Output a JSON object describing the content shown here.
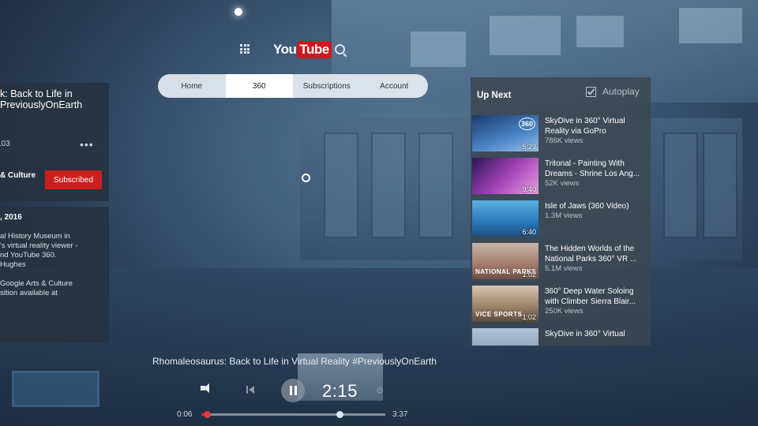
{
  "nav": {
    "tabs": [
      {
        "label": "Home"
      },
      {
        "label": "360",
        "active": true
      },
      {
        "label": "Subscriptions"
      },
      {
        "label": "Account"
      }
    ],
    "logo_you": "You",
    "logo_tube": "Tube"
  },
  "video_info": {
    "title_line1": "k: Back to Life in",
    "title_line2": "PreviouslyOnEarth",
    "likes": "103",
    "channel": "& Culture",
    "subscribe_label": "Subscribed",
    "date": ", 2016",
    "description": [
      "al History Museum in",
      "'s virtual reality viewer -",
      "nd YouTube 360.",
      "Hughes",
      "",
      "Google Arts & Culture",
      "sition available at"
    ]
  },
  "up_next": {
    "heading": "Up Next",
    "autoplay_label": "Autoplay",
    "autoplay_checked": true,
    "videos": [
      {
        "title1": "SkyDive in 360° Virtual",
        "title2": "Reality via GoPro",
        "views": "786K views",
        "duration": "5:29",
        "badge": "360"
      },
      {
        "title1": "Tritonal - Painting With",
        "title2": "Dreams - Shrine Los Ang...",
        "views": "52K views",
        "duration": "9:40"
      },
      {
        "title1": "Isle of Jaws (360 Video)",
        "title2": "",
        "views": "1.3M views",
        "duration": "6:40"
      },
      {
        "title1": "The Hidden Worlds of the",
        "title2": "National Parks 360° VR ...",
        "views": "5.1M views",
        "duration": "1:02",
        "thumb_text": "NATIONAL PARKS"
      },
      {
        "title1": "360° Deep Water Soloing",
        "title2": "with Climber Sierra Blair...",
        "views": "250K views",
        "duration": "1:02",
        "thumb_text": "VICE SPORTS"
      },
      {
        "title1": "SkyDive in 360° Virtual",
        "title2": "",
        "views": "",
        "duration": ""
      }
    ]
  },
  "player": {
    "video_title": "Rhomaleosaurus: Back to Life in Virtual Reality #PreviouslyOnEarth",
    "hover_time": "2:15",
    "current_time": "0:06",
    "total_time": "3:37",
    "progress_fraction": 0.028,
    "hover_fraction": 0.75
  }
}
